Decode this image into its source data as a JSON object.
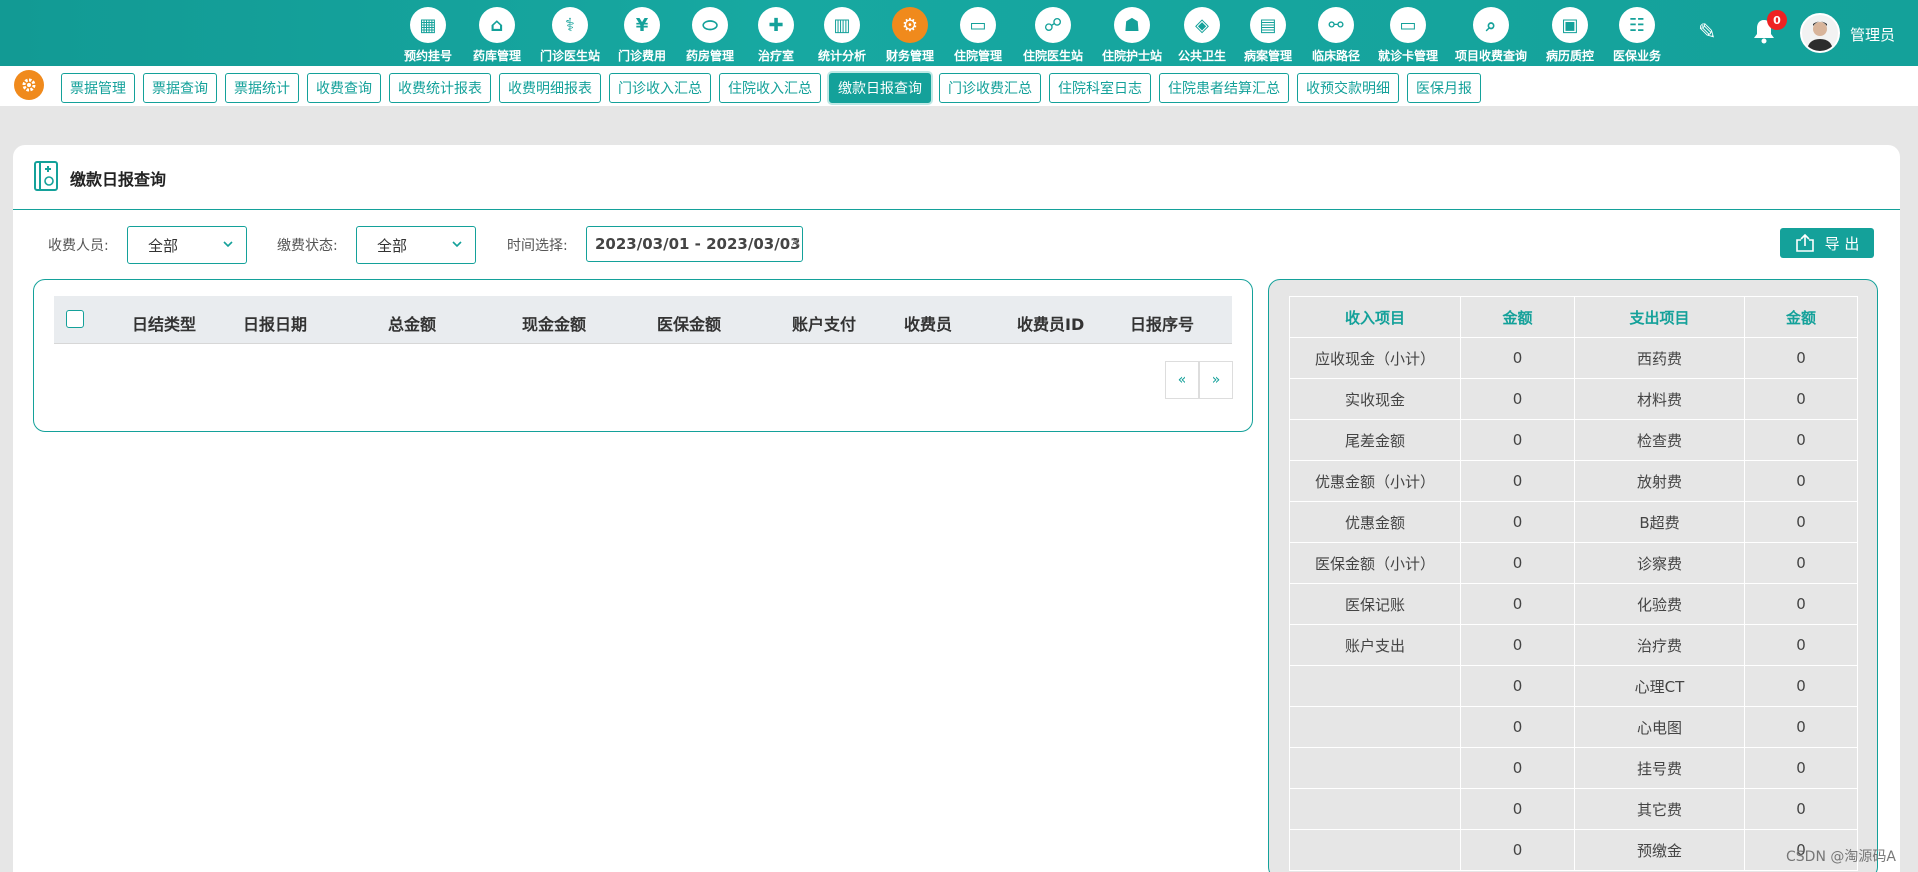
{
  "nav": {
    "items": [
      {
        "label": "预约挂号",
        "icon": "calendar-icon",
        "glyph": "▦"
      },
      {
        "label": "药库管理",
        "icon": "pharmacy-home-icon",
        "glyph": "⌂"
      },
      {
        "label": "门诊医生站",
        "icon": "doctor-icon",
        "glyph": "⚕"
      },
      {
        "label": "门诊费用",
        "icon": "yen-icon",
        "glyph": "¥"
      },
      {
        "label": "药房管理",
        "icon": "pill-icon",
        "glyph": "⬭"
      },
      {
        "label": "治疗室",
        "icon": "nurse-icon",
        "glyph": "✚"
      },
      {
        "label": "统计分析",
        "icon": "bar-chart-icon",
        "glyph": "▥"
      },
      {
        "label": "财务管理",
        "icon": "gear-icon",
        "glyph": "⚙"
      },
      {
        "label": "住院管理",
        "icon": "bed-icon",
        "glyph": "▭"
      },
      {
        "label": "住院医生站",
        "icon": "doctor-group-icon",
        "glyph": "☍"
      },
      {
        "label": "住院护士站",
        "icon": "nurse-station-icon",
        "glyph": "☗"
      },
      {
        "label": "公共卫生",
        "icon": "health-icon",
        "glyph": "◈"
      },
      {
        "label": "病案管理",
        "icon": "record-icon",
        "glyph": "▤"
      },
      {
        "label": "临床路径",
        "icon": "path-icon",
        "glyph": "⚯"
      },
      {
        "label": "就诊卡管理",
        "icon": "card-icon",
        "glyph": "▭"
      },
      {
        "label": "项目收费查询",
        "icon": "search-doc-icon",
        "glyph": "⌕"
      },
      {
        "label": "病历质控",
        "icon": "shield-doc-icon",
        "glyph": "▣"
      },
      {
        "label": "医保业务",
        "icon": "insurance-card-icon",
        "glyph": "☷"
      }
    ],
    "active_index": 7,
    "notification_count": "0",
    "user_name": "管理员"
  },
  "subnav": {
    "tabs": [
      "票据管理",
      "票据查询",
      "票据统计",
      "收费查询",
      "收费统计报表",
      "收费明细报表",
      "门诊收入汇总",
      "住院收入汇总",
      "缴款日报查询",
      "门诊收费汇总",
      "住院科室日志",
      "住院患者结算汇总",
      "收预交款明细",
      "医保月报"
    ],
    "active_index": 8
  },
  "page": {
    "title": "缴款日报查询",
    "filters": {
      "collector_label": "收费人员:",
      "collector_value": "全部",
      "status_label": "缴费状态:",
      "status_value": "全部",
      "time_label": "时间选择:",
      "time_value": "2023/03/01 - 2023/03/03",
      "clear": "×"
    },
    "export_label": "导 出"
  },
  "left_table": {
    "columns": [
      "日结类型",
      "日报日期",
      "总金额",
      "现金金额",
      "医保金额",
      "账户支付",
      "收费员",
      "收费员ID",
      "日报序号"
    ],
    "rows": [],
    "pager_prev": "«",
    "pager_next": "»"
  },
  "summary": {
    "headers": [
      "收入项目",
      "金额",
      "支出项目",
      "金额"
    ],
    "rows": [
      [
        "应收现金（小计）",
        "0",
        "西药费",
        "0"
      ],
      [
        "实收现金",
        "0",
        "材料费",
        "0"
      ],
      [
        "尾差金额",
        "0",
        "检查费",
        "0"
      ],
      [
        "优惠金额（小计）",
        "0",
        "放射费",
        "0"
      ],
      [
        "优惠金额",
        "0",
        "B超费",
        "0"
      ],
      [
        "医保金额（小计）",
        "0",
        "诊察费",
        "0"
      ],
      [
        "医保记账",
        "0",
        "化验费",
        "0"
      ],
      [
        "账户支出",
        "0",
        "治疗费",
        "0"
      ],
      [
        "",
        "0",
        "心理CT",
        "0"
      ],
      [
        "",
        "0",
        "心电图",
        "0"
      ],
      [
        "",
        "0",
        "挂号费",
        "0"
      ],
      [
        "",
        "0",
        "其它费",
        "0"
      ],
      [
        "",
        "0",
        "预缴金",
        "0"
      ]
    ]
  },
  "watermark": "CSDN @淘源码A",
  "colors": {
    "primary": "#14a19a",
    "accent": "#f08a1c",
    "badge": "#e22222"
  }
}
